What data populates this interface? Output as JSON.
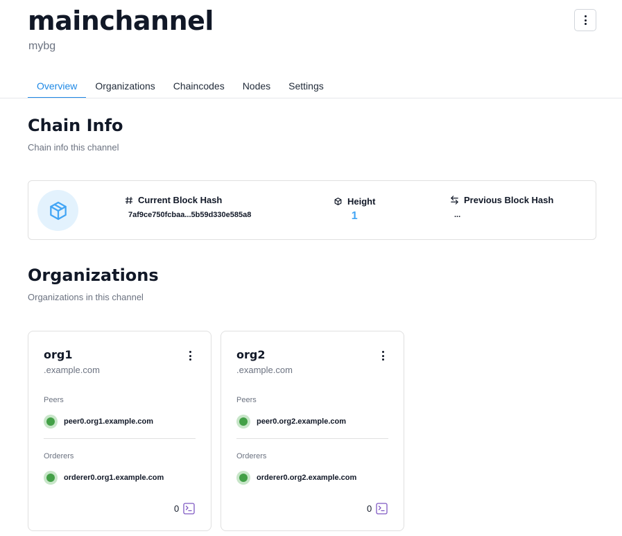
{
  "header": {
    "title": "mainchannel",
    "subtitle": "mybg"
  },
  "tabs": [
    {
      "label": "Overview",
      "active": true
    },
    {
      "label": "Organizations"
    },
    {
      "label": "Chaincodes"
    },
    {
      "label": "Nodes"
    },
    {
      "label": "Settings"
    }
  ],
  "chain_info": {
    "title": "Chain Info",
    "subtitle": "Chain info this channel",
    "current_block_hash": {
      "label": "Current Block Hash",
      "value": "7af9ce750fcbaa...5b59d330e585a8",
      "icon": "hash-icon"
    },
    "height": {
      "label": "Height",
      "value": "1",
      "icon": "cube-icon"
    },
    "previous_block_hash": {
      "label": "Previous Block Hash",
      "value": "...",
      "icon": "swap-arrows-icon"
    }
  },
  "organizations": {
    "title": "Organizations",
    "subtitle": "Organizations in this channel",
    "peers_label": "Peers",
    "orderers_label": "Orderers",
    "items": [
      {
        "name": "org1",
        "domain": ".example.com",
        "peer": "peer0.org1.example.com",
        "orderer": "orderer0.org1.example.com",
        "chaincodes": "0"
      },
      {
        "name": "org2",
        "domain": ".example.com",
        "peer": "peer0.org2.example.com",
        "orderer": "orderer0.org2.example.com",
        "chaincodes": "0"
      }
    ]
  },
  "colors": {
    "accent": "#1e88e5",
    "height_value": "#42a5f5",
    "status_online": "#43a047",
    "chaincode_icon": "#7e57c2"
  }
}
